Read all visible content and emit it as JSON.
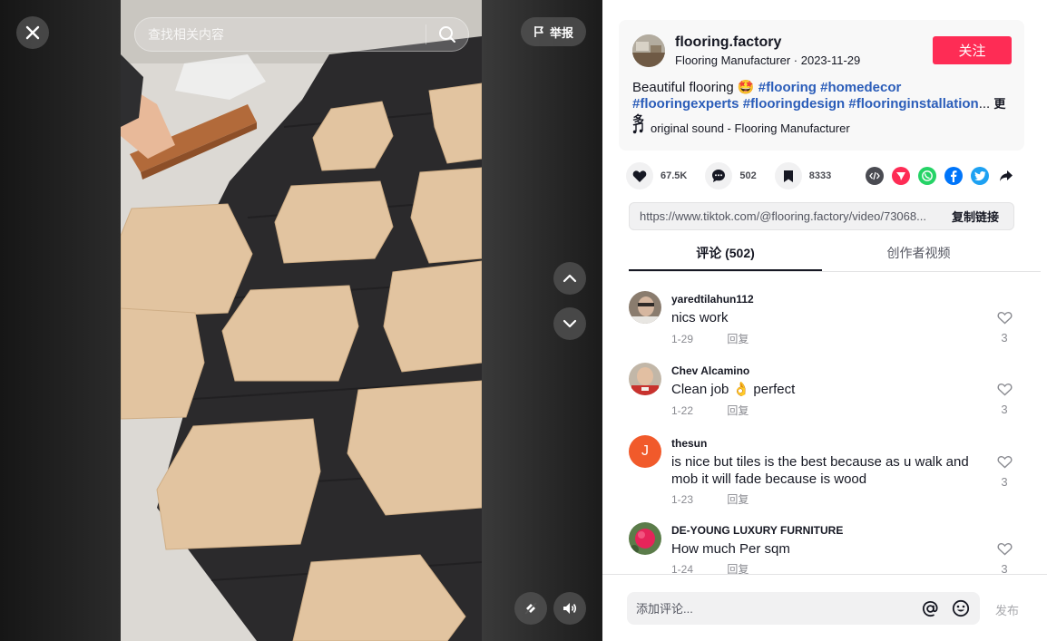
{
  "video": {
    "search_placeholder": "查找相关内容",
    "report_label": "举报"
  },
  "author": {
    "username": "flooring.factory",
    "nickname": "Flooring Manufacturer",
    "separator": " · ",
    "date": "2023-11-29",
    "follow_label": "关注"
  },
  "description": {
    "text": "Beautiful flooring",
    "emoji": "🤩",
    "hashtags": [
      "#flooring",
      "#homedecor",
      "#flooringexperts",
      "#flooringdesign",
      "#flooringinstallation"
    ],
    "ellipsis": "...",
    "more_label": "更多"
  },
  "music": {
    "icon": "music-note-icon",
    "label": "original sound - Flooring Manufacturer"
  },
  "stats": {
    "likes": "67.5K",
    "comments": "502",
    "saves": "8333"
  },
  "share_icons": [
    "embed-icon",
    "send-to-friends-icon",
    "whatsapp-icon",
    "facebook-icon",
    "twitter-icon",
    "share-arrow-icon"
  ],
  "colors": {
    "accent": "#fe2c55",
    "hashtag": "#2b5db9",
    "whatsapp": "#25d366",
    "facebook": "#0075fa",
    "twitter": "#1da1f2",
    "embed": "#4a4b52"
  },
  "link": {
    "url": "https://www.tiktok.com/@flooring.factory/video/73068...",
    "copy_label": "复制链接"
  },
  "tabs": [
    {
      "label": "评论 (502)",
      "active": true
    },
    {
      "label": "创作者视频",
      "active": false
    }
  ],
  "comments": [
    {
      "user": "yaredtilahun112",
      "text": "nics work",
      "date": "1-29",
      "reply": "回复",
      "likes": "3"
    },
    {
      "user": "Chev Alcamino",
      "text": "Clean job 👌 perfect",
      "date": "1-22",
      "reply": "回复",
      "likes": "3"
    },
    {
      "user": "thesun",
      "avatar_letter": "J",
      "text": "is nice but tiles is the best because as u walk and mob it will fade because is wood",
      "date": "1-23",
      "reply": "回复",
      "likes": "3"
    },
    {
      "user": "DE-YOUNG LUXURY FURNITURE",
      "text": "How much Per sqm",
      "date": "1-24",
      "reply": "回复",
      "likes": "3"
    }
  ],
  "composer": {
    "placeholder": "添加评论...",
    "post_label": "发布"
  }
}
